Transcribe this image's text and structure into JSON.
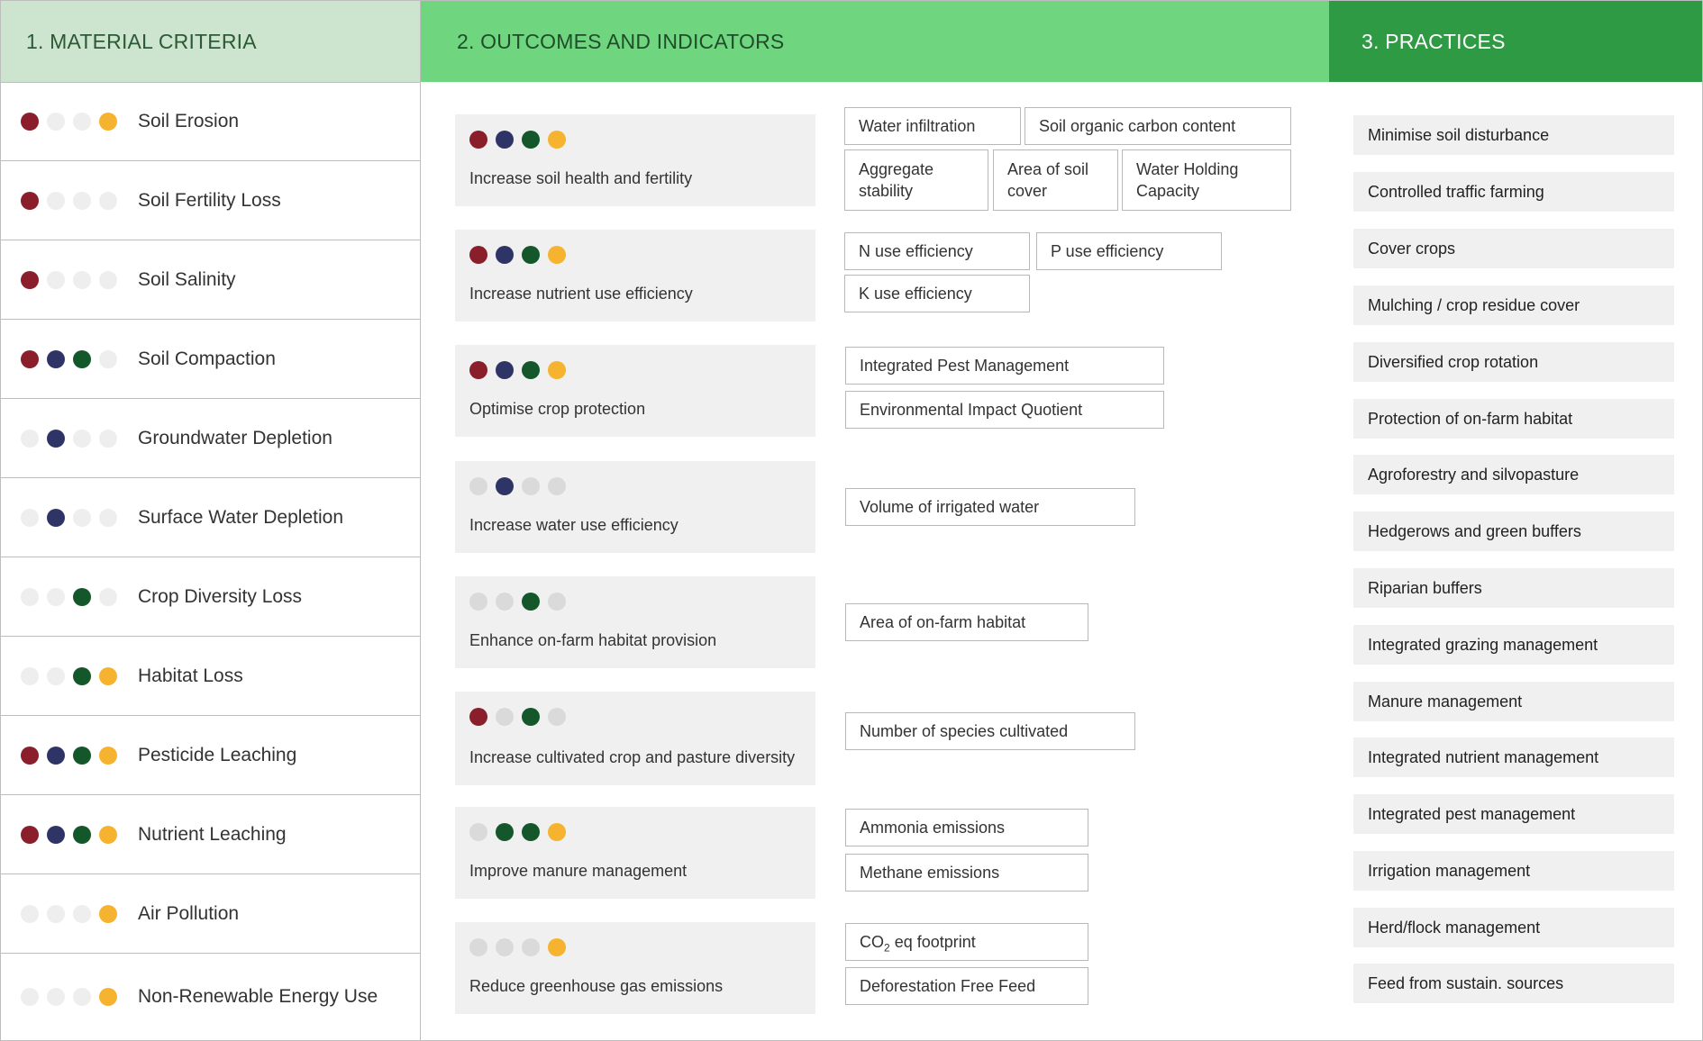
{
  "colors": {
    "red": "#8b1e2b",
    "navy": "#2e3566",
    "green": "#14572b",
    "amber": "#f6b330",
    "off": "#eeeeee",
    "off_outcome": "#dadada"
  },
  "headers": {
    "material": "1. MATERIAL CRITERIA",
    "outcomes": "2. OUTCOMES AND INDICATORS",
    "practices": "3. PRACTICES"
  },
  "criteria": [
    {
      "label": "Soil Erosion",
      "dots": [
        "red",
        "off",
        "off",
        "amber"
      ]
    },
    {
      "label": "Soil Fertility Loss",
      "dots": [
        "red",
        "off",
        "off",
        "off"
      ]
    },
    {
      "label": "Soil Salinity",
      "dots": [
        "red",
        "off",
        "off",
        "off"
      ]
    },
    {
      "label": "Soil Compaction",
      "dots": [
        "red",
        "navy",
        "green",
        "off"
      ]
    },
    {
      "label": "Groundwater Depletion",
      "dots": [
        "off",
        "navy",
        "off",
        "off"
      ]
    },
    {
      "label": "Surface Water Depletion",
      "dots": [
        "off",
        "navy",
        "off",
        "off"
      ]
    },
    {
      "label": "Crop Diversity Loss",
      "dots": [
        "off",
        "off",
        "green",
        "off"
      ]
    },
    {
      "label": "Habitat Loss",
      "dots": [
        "off",
        "off",
        "green",
        "amber"
      ]
    },
    {
      "label": "Pesticide Leaching",
      "dots": [
        "red",
        "navy",
        "green",
        "amber"
      ]
    },
    {
      "label": "Nutrient Leaching",
      "dots": [
        "red",
        "navy",
        "green",
        "amber"
      ]
    },
    {
      "label": "Air Pollution",
      "dots": [
        "off",
        "off",
        "off",
        "amber"
      ]
    },
    {
      "label": "Non-Renewable Energy Use",
      "dots": [
        "off",
        "off",
        "off",
        "amber"
      ]
    }
  ],
  "outcomes": [
    {
      "label": "Increase soil health and fertility",
      "dots": [
        "red",
        "navy",
        "green",
        "amber"
      ],
      "indicators": [
        "Water infiltration",
        "Soil organic carbon content",
        "Aggregate stability",
        "Area of soil cover",
        "Water Holding Capacity"
      ]
    },
    {
      "label": "Increase nutrient use efficiency",
      "dots": [
        "red",
        "navy",
        "green",
        "amber"
      ],
      "indicators": [
        "N use efficiency",
        "P use efficiency",
        "K use efficiency"
      ]
    },
    {
      "label": "Optimise crop protection",
      "dots": [
        "red",
        "navy",
        "green",
        "amber"
      ],
      "indicators": [
        "Integrated Pest Management",
        "Environmental Impact Quotient"
      ]
    },
    {
      "label": "Increase water use efficiency",
      "dots": [
        "off",
        "navy",
        "off",
        "off"
      ],
      "indicators": [
        "Volume of irrigated water"
      ]
    },
    {
      "label": "Enhance on-farm habitat provision",
      "dots": [
        "off",
        "off",
        "green",
        "off"
      ],
      "indicators": [
        "Area of on-farm habitat"
      ]
    },
    {
      "label": "Increase cultivated crop and pasture diversity",
      "dots": [
        "red",
        "off",
        "green",
        "off"
      ],
      "indicators": [
        "Number of species cultivated"
      ]
    },
    {
      "label": "Improve manure management",
      "dots": [
        "off",
        "green",
        "green",
        "amber"
      ],
      "indicators": [
        "Ammonia emissions",
        "Methane emissions"
      ]
    },
    {
      "label": "Reduce greenhouse gas emissions",
      "dots": [
        "off",
        "off",
        "off",
        "amber"
      ],
      "indicators": [
        "CO",
        "2",
        " eq footprint",
        "Deforestation Free Feed"
      ]
    }
  ],
  "practices": [
    "Minimise soil disturbance",
    "Controlled traffic farming",
    "Cover crops",
    "Mulching / crop residue cover",
    "Diversified crop rotation",
    "Protection of on-farm habitat",
    "Agroforestry and silvopasture",
    "Hedgerows and green buffers",
    "Riparian buffers",
    "Integrated grazing management",
    "Manure management",
    "Integrated nutrient management",
    "Integrated pest management",
    "Irrigation management",
    "Herd/flock management",
    "Feed from sustain. sources"
  ]
}
